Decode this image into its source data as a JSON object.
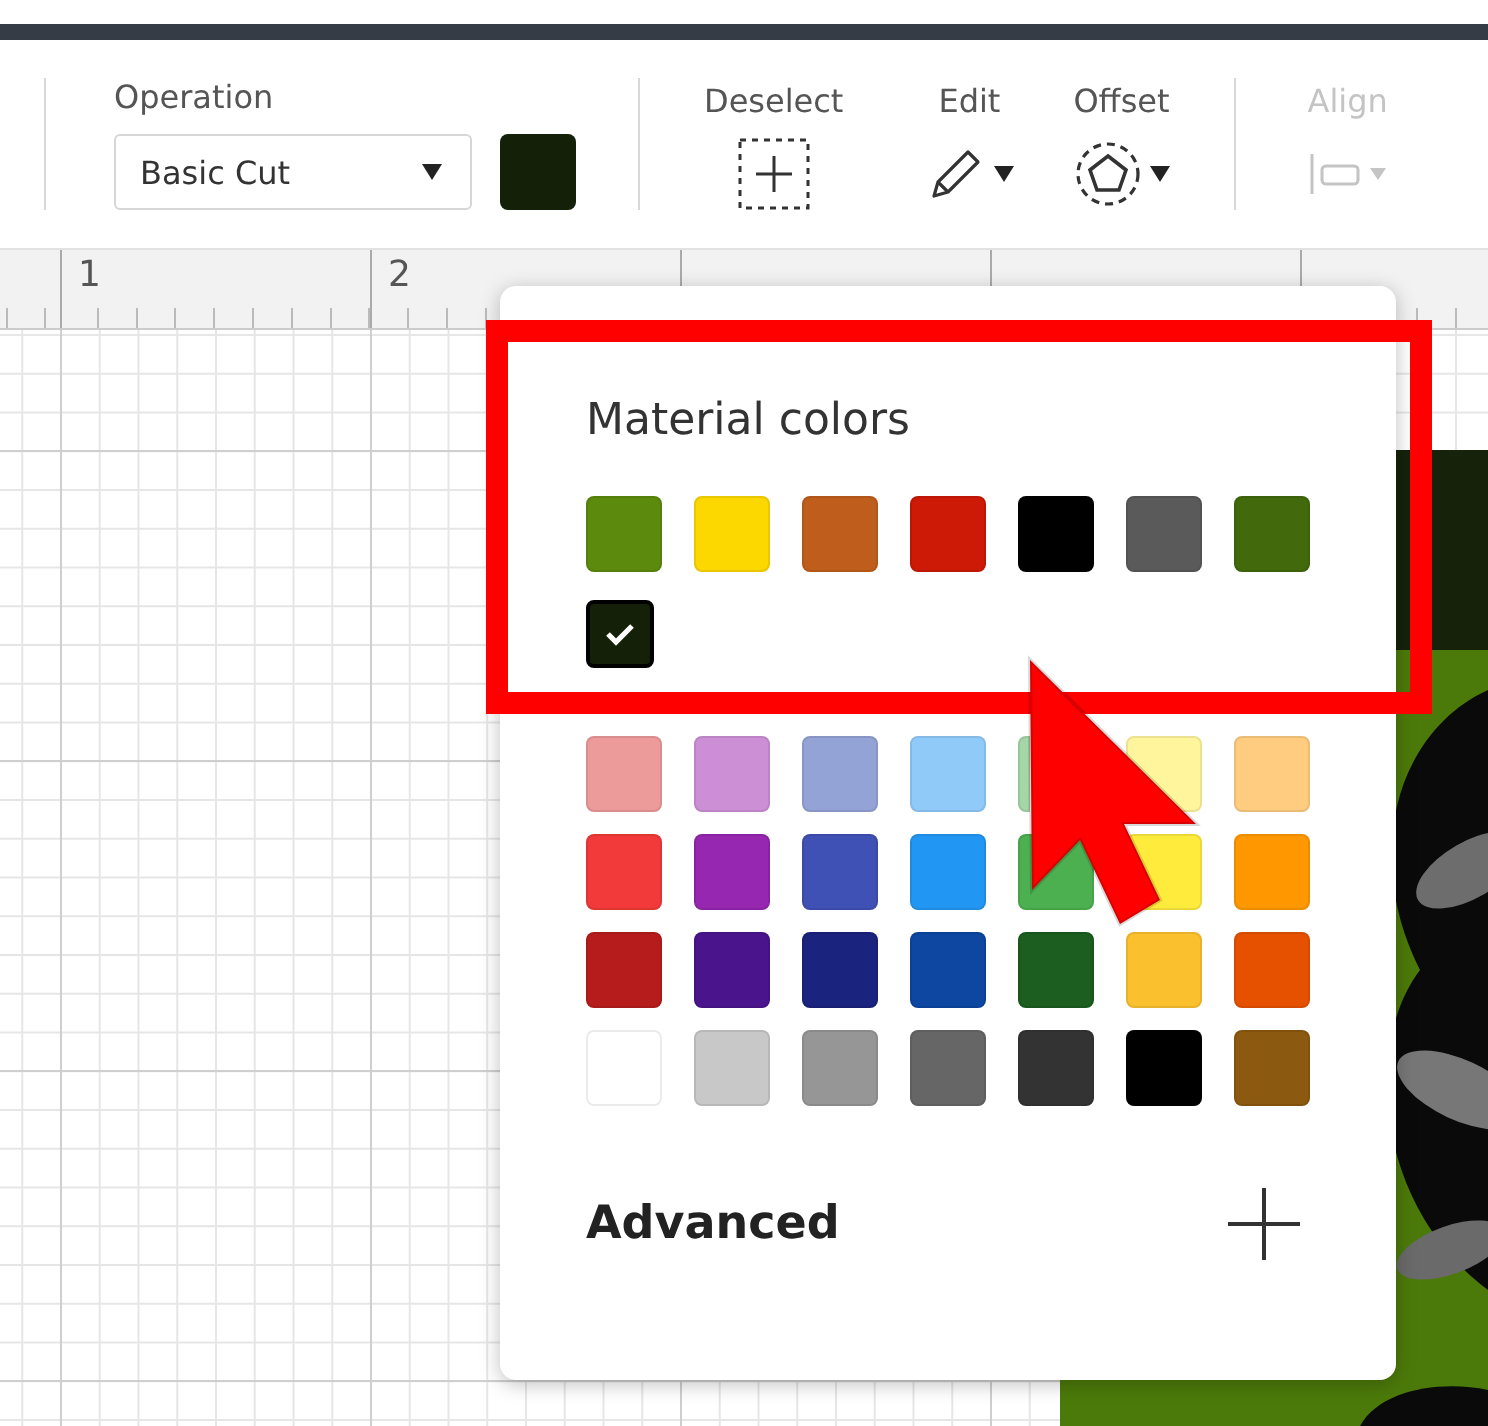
{
  "toolbar": {
    "groups": [
      {
        "kind": "operation",
        "label": "Operation",
        "value": "Basic Cut",
        "color": "#142008",
        "disabled": false
      },
      {
        "kind": "deselect",
        "label": "Deselect",
        "disabled": false
      },
      {
        "kind": "edit",
        "label": "Edit",
        "disabled": false
      },
      {
        "kind": "offset",
        "label": "Offset",
        "disabled": false
      },
      {
        "kind": "align",
        "label": "Align",
        "disabled": true
      }
    ]
  },
  "ruler": {
    "labels": [
      "1",
      "2"
    ]
  },
  "color_popup": {
    "title": "Material colors",
    "material_colors": [
      {
        "color": "#5c8a0c",
        "selected": false
      },
      {
        "color": "#fcd700",
        "selected": false
      },
      {
        "color": "#bf5e1c",
        "selected": false
      },
      {
        "color": "#cc1a06",
        "selected": false
      },
      {
        "color": "#000000",
        "selected": false
      },
      {
        "color": "#5a5a5a",
        "selected": false
      },
      {
        "color": "#426a0c",
        "selected": false
      },
      {
        "color": "#142008",
        "selected": true
      }
    ],
    "palette": [
      {
        "color": "#ec9a9a"
      },
      {
        "color": "#cc8fd6"
      },
      {
        "color": "#94a3d6"
      },
      {
        "color": "#90caf9"
      },
      {
        "color": "#a5d6a7",
        "kind": "clipped"
      },
      {
        "color": "#fff59d"
      },
      {
        "color": "#ffcc80"
      },
      {
        "color": "#f23a3a"
      },
      {
        "color": "#9527b0"
      },
      {
        "color": "#3f51b5"
      },
      {
        "color": "#2196f3"
      },
      {
        "color": "#4caf50"
      },
      {
        "color": "#ffeb3b"
      },
      {
        "color": "#ff9800"
      },
      {
        "color": "#b71c1c"
      },
      {
        "color": "#4a148c"
      },
      {
        "color": "#1a237e"
      },
      {
        "color": "#0d47a1"
      },
      {
        "color": "#1b5e20"
      },
      {
        "color": "#fbc02d"
      },
      {
        "color": "#e65100"
      },
      {
        "color": "#ffffff"
      },
      {
        "color": "#c8c8c8"
      },
      {
        "color": "#969696"
      },
      {
        "color": "#666666"
      },
      {
        "color": "#333333"
      },
      {
        "color": "#000000"
      },
      {
        "color": "#8b5a10"
      }
    ],
    "advanced": {
      "label": "Advanced",
      "expanded": false
    }
  }
}
